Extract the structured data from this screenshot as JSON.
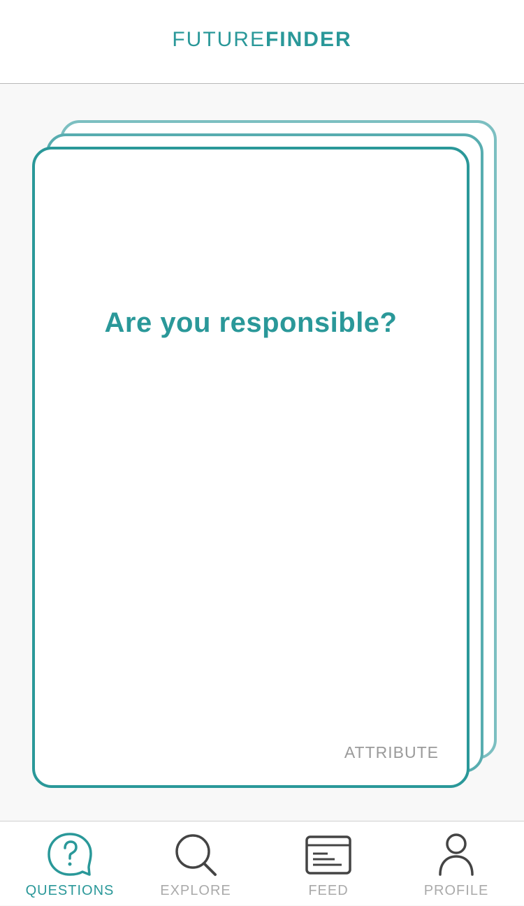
{
  "app": {
    "logo_light": "FUTURE",
    "logo_bold": "FINDER"
  },
  "card": {
    "question": "Are you responsible?",
    "category": "ATTRIBUTE"
  },
  "tabs": [
    {
      "label": "QUESTIONS",
      "icon": "question-bubble-icon",
      "active": true
    },
    {
      "label": "EXPLORE",
      "icon": "search-icon",
      "active": false
    },
    {
      "label": "FEED",
      "icon": "feed-icon",
      "active": false
    },
    {
      "label": "PROFILE",
      "icon": "person-icon",
      "active": false
    }
  ],
  "colors": {
    "accent": "#2a9899",
    "inactive": "#aaaaaa",
    "icon_dark": "#444444"
  }
}
